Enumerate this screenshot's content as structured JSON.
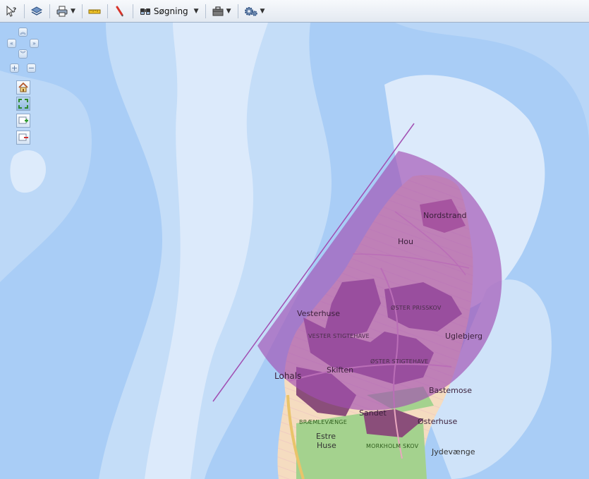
{
  "toolbar": {
    "search_label": "Søgning",
    "tools": [
      {
        "name": "identify-tool",
        "icon": "cursor-question-icon"
      },
      {
        "name": "layers-tool",
        "icon": "layers-icon"
      },
      {
        "name": "print-tool",
        "icon": "printer-icon"
      },
      {
        "name": "measure-tool",
        "icon": "ruler-icon"
      },
      {
        "name": "draw-tool",
        "icon": "marker-icon"
      },
      {
        "name": "search-tool",
        "icon": "binoculars-icon"
      },
      {
        "name": "toolbox-tool",
        "icon": "toolbox-icon"
      },
      {
        "name": "settings-tool",
        "icon": "gears-icon"
      }
    ]
  },
  "nav": {
    "pan_up": "pan-up-icon",
    "pan_left": "pan-left-icon",
    "pan_right": "pan-right-icon",
    "pan_down": "pan-down-icon",
    "zoom_in": "+",
    "zoom_out": "−"
  },
  "map_tools": [
    {
      "name": "home-button",
      "icon": "home-icon"
    },
    {
      "name": "zoom-extent-button",
      "icon": "zoom-extent-icon"
    },
    {
      "name": "zoom-in-box-button",
      "icon": "zoom-in-box-icon"
    },
    {
      "name": "zoom-out-box-button",
      "icon": "zoom-out-box-icon"
    }
  ],
  "places": {
    "nordstrand": "Nordstrand",
    "hou": "Hou",
    "vesterhuse": "Vesterhuse",
    "oster_prisskov": "ØSTER PRISSKOV",
    "vester_stigtehave": "VESTER STIGTEHAVE",
    "uglebjerg": "Uglebjerg",
    "oster_stigtehave": "ØSTER STIGTEHAVE",
    "lohals": "Lohals",
    "skiften": "Skiften",
    "bastemose": "Bastemose",
    "sandet": "Sandet",
    "osterhuse": "Østerhuse",
    "braemlevaenge": "BRÆMLEVÆNGE",
    "estre": "Estre",
    "huse": "Huse",
    "morkholm_skov": "MORKHOLM SKOV",
    "jydevaenge": "Jydevænge"
  },
  "colors": {
    "sea_deep": "#a8cdf5",
    "sea_mid": "#c3dcf8",
    "sea_shallow": "#dbeafb",
    "land": "#f4dcc0",
    "forest": "#9ccf86",
    "buffer": "#a24db0",
    "road": "#e7c97a"
  }
}
